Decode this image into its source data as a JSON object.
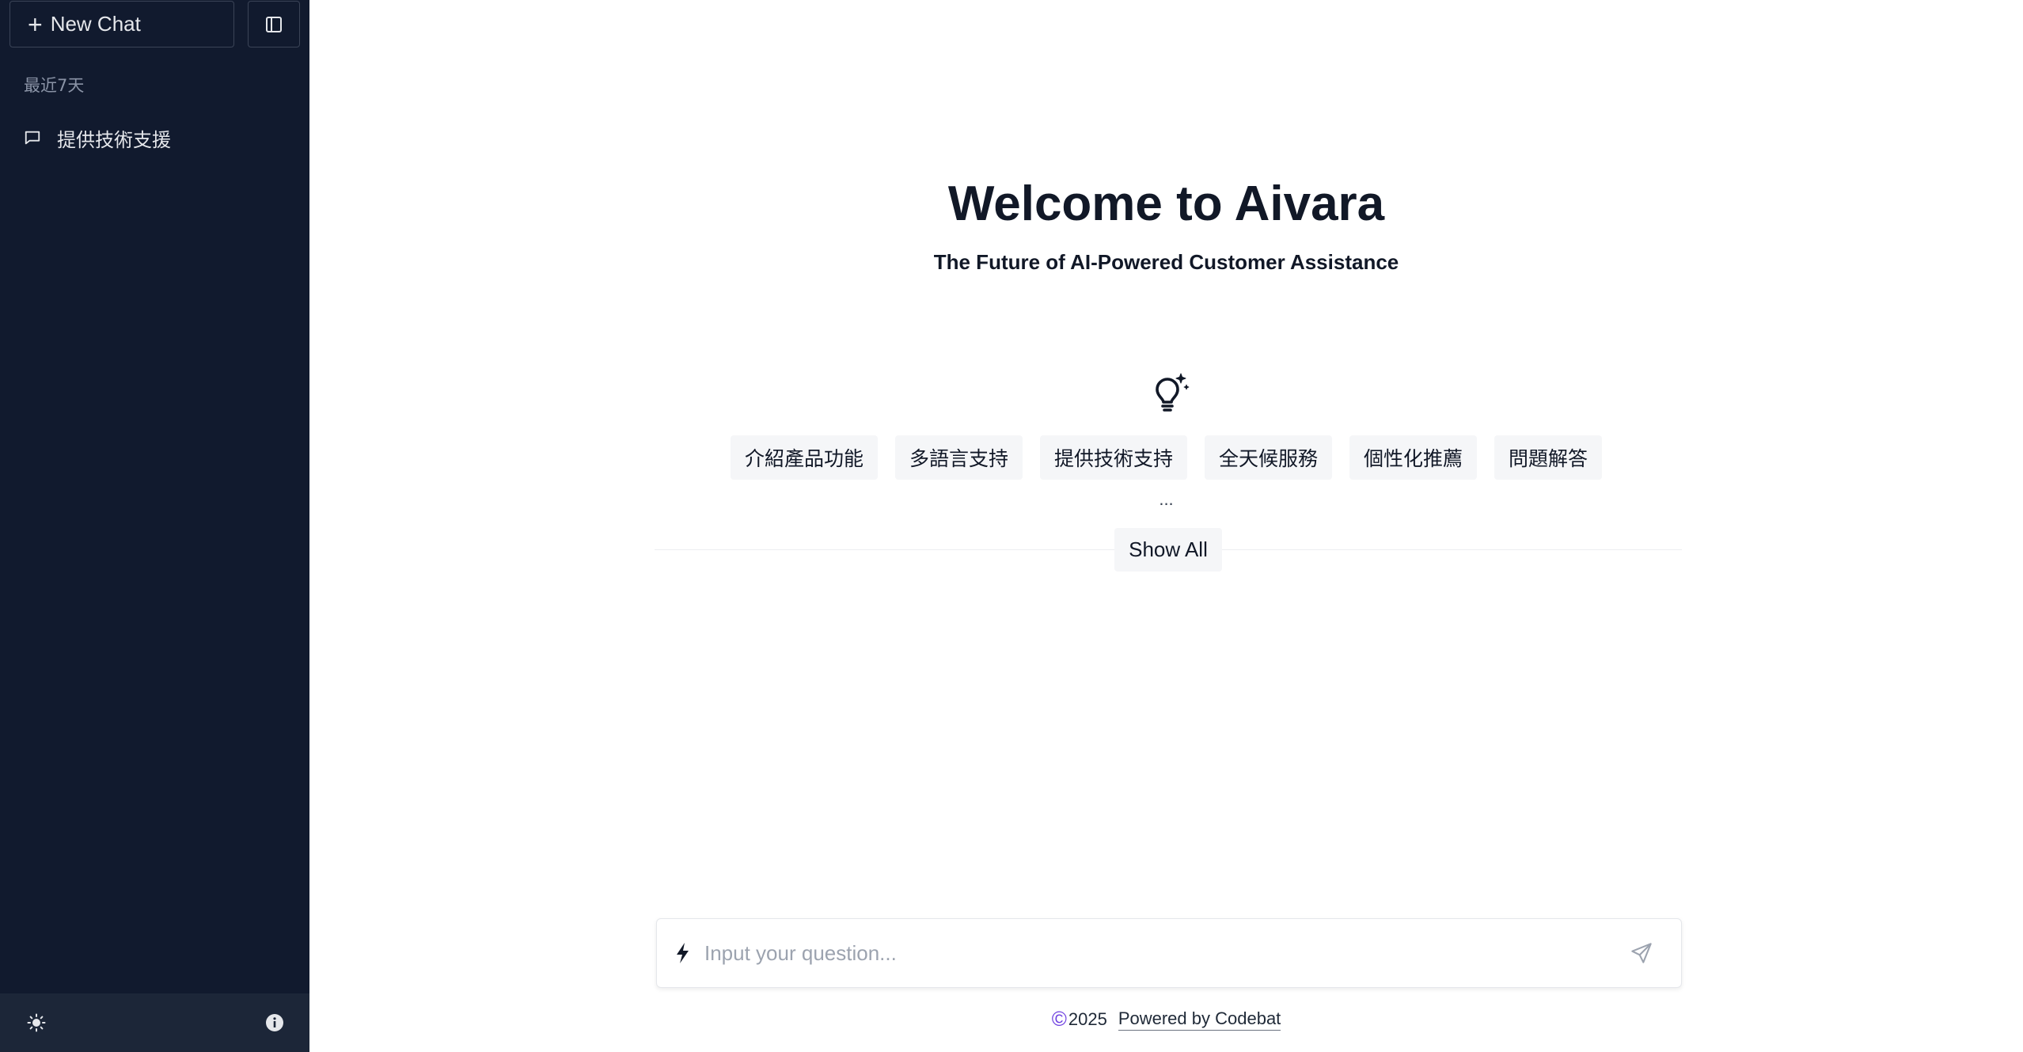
{
  "sidebar": {
    "new_chat_label": "New Chat",
    "section_label": "最近7天",
    "history": [
      {
        "label": "提供技術支援"
      }
    ]
  },
  "main": {
    "title": "Welcome to Aivara",
    "subtitle": "The Future of AI-Powered Customer Assistance",
    "suggestions": [
      "介紹產品功能",
      "多語言支持",
      "提供技術支持",
      "全天候服務",
      "個性化推薦",
      "問題解答"
    ],
    "ellipsis": "...",
    "show_all_label": "Show All",
    "input": {
      "placeholder": "Input your question...",
      "value": ""
    },
    "footer": {
      "copyright_symbol": "©",
      "year": "2025",
      "powered_by": "Powered by Codebat"
    }
  },
  "icons": {
    "new_chat": "plus-icon",
    "toggle_sidebar": "sidebar-panel-icon",
    "history_item": "chat-bubble-icon",
    "theme": "sun-icon",
    "info": "info-icon",
    "suggestions": "lightbulb-sparkle-icon",
    "input_prefix": "lightning-bolt-icon",
    "send": "send-icon"
  },
  "colors": {
    "sidebar_bg": "#111a2e",
    "sidebar_footer_bg": "#1c2638",
    "accent": "#6d3fe0"
  }
}
